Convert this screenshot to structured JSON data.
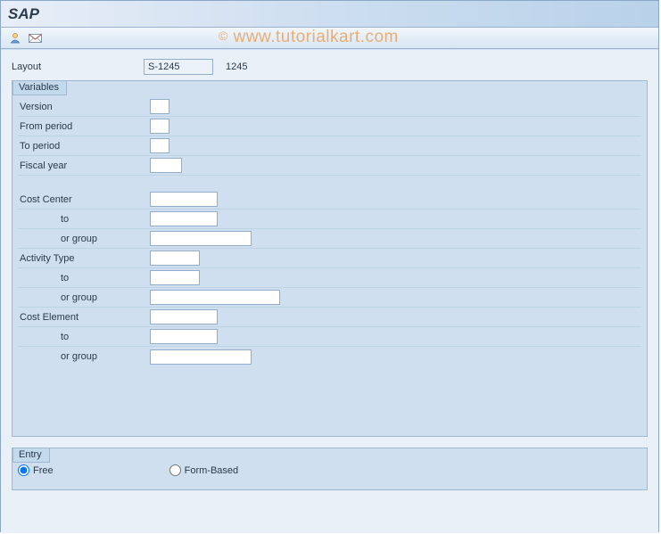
{
  "title": "SAP",
  "watermark": "www.tutorialkart.com",
  "layout": {
    "label": "Layout",
    "value": "S-1245",
    "desc": "1245"
  },
  "variables": {
    "title": "Variables",
    "version_label": "Version",
    "version_value": "",
    "from_period_label": "From period",
    "from_period_value": "",
    "to_period_label": "To period",
    "to_period_value": "",
    "fiscal_year_label": "Fiscal year",
    "fiscal_year_value": "",
    "cost_center_label": "Cost Center",
    "cost_center_value": "",
    "cc_to_label": "to",
    "cc_to_value": "",
    "cc_group_label": "or group",
    "cc_group_value": "",
    "activity_type_label": "Activity Type",
    "activity_type_value": "",
    "at_to_label": "to",
    "at_to_value": "",
    "at_group_label": "or group",
    "at_group_value": "",
    "cost_element_label": "Cost Element",
    "cost_element_value": "",
    "ce_to_label": "to",
    "ce_to_value": "",
    "ce_group_label": "or group",
    "ce_group_value": ""
  },
  "entry": {
    "title": "Entry",
    "free_label": "Free",
    "form_label": "Form-Based",
    "selected": "free"
  }
}
